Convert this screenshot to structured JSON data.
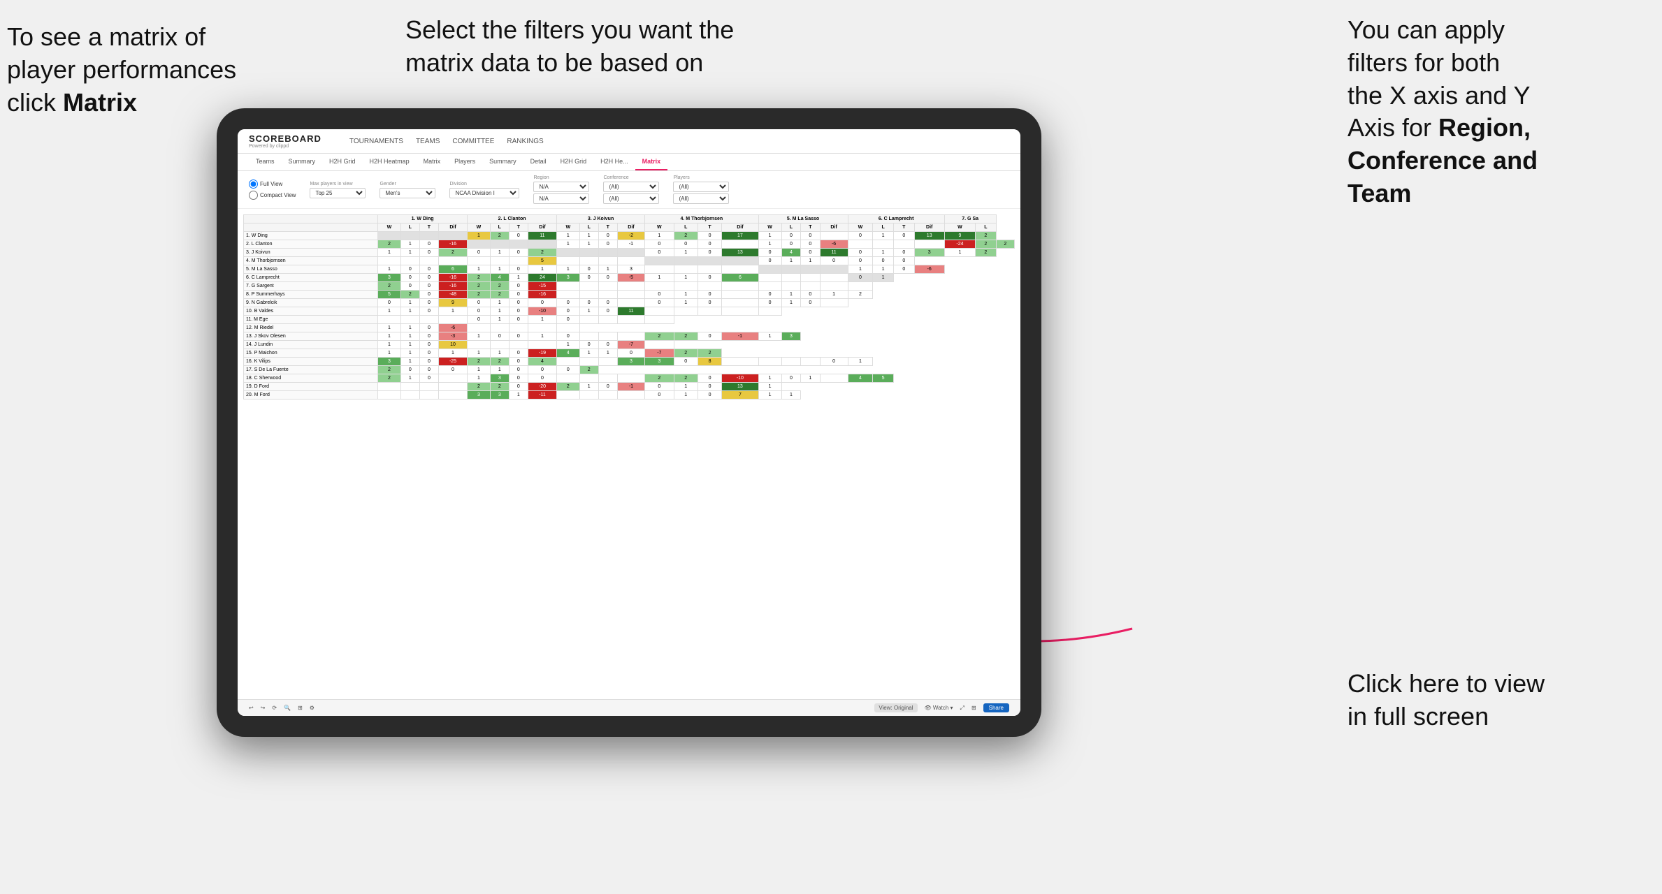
{
  "annotations": {
    "topleft": {
      "line1": "To see a matrix of",
      "line2": "player performances",
      "line3_normal": "click ",
      "line3_bold": "Matrix"
    },
    "topcenter": {
      "text": "Select the filters you want the matrix data to be based on"
    },
    "topright": {
      "line1": "You  can apply",
      "line2": "filters for both",
      "line3": "the X axis and Y",
      "line4_normal": "Axis for ",
      "line4_bold": "Region,",
      "line5": "Conference and",
      "line6": "Team"
    },
    "bottomright": {
      "line1": "Click here to view",
      "line2": "in full screen"
    }
  },
  "scoreboard": {
    "brand": "SCOREBOARD",
    "brand_sub": "Powered by clippd",
    "top_nav": [
      "TOURNAMENTS",
      "TEAMS",
      "COMMITTEE",
      "RANKINGS"
    ],
    "sub_tabs": [
      "Teams",
      "Summary",
      "H2H Grid",
      "H2H Heatmap",
      "Matrix",
      "Players",
      "Summary",
      "Detail",
      "H2H Grid",
      "H2H He...",
      "Matrix"
    ],
    "active_tab": "Matrix"
  },
  "filters": {
    "view_options": [
      "Full View",
      "Compact View"
    ],
    "max_players": {
      "label": "Max players in view",
      "value": "Top 25"
    },
    "gender": {
      "label": "Gender",
      "value": "Men's"
    },
    "division": {
      "label": "Division",
      "value": "NCAA Division I"
    },
    "region": {
      "label": "Region",
      "value": "N/A"
    },
    "conference": {
      "label": "Conference",
      "value": "(All)"
    },
    "players": {
      "label": "Players",
      "value": "(All)"
    },
    "region2": {
      "label": "",
      "value": "N/A"
    },
    "conference2": {
      "label": "",
      "value": "(All)"
    },
    "players2": {
      "label": "",
      "value": "(All)"
    }
  },
  "matrix": {
    "col_headers": [
      "1. W Ding",
      "2. L Clanton",
      "3. J Koivun",
      "4. M Thorbjornsen",
      "5. M La Sasso",
      "6. C Lamprecht",
      "7. G Sa"
    ],
    "sub_headers": [
      "W",
      "L",
      "T",
      "Dif"
    ],
    "rows": [
      {
        "name": "1. W Ding",
        "cells": [
          "",
          "",
          "",
          "",
          "1",
          "2",
          "0",
          "11",
          "1",
          "1",
          "0",
          "-2",
          "1",
          "2",
          "0",
          "17",
          "1",
          "0",
          "0",
          "",
          "0",
          "1",
          "0",
          "13",
          "9",
          "2"
        ]
      },
      {
        "name": "2. L Clanton",
        "cells": [
          "2",
          "1",
          "0",
          "-16",
          "",
          "",
          "",
          "",
          "1",
          "1",
          "0",
          "-1",
          "0",
          "0",
          "0",
          "",
          "1",
          "0",
          "0",
          "-6",
          "",
          "",
          "",
          "",
          "-24",
          "2",
          "2"
        ]
      },
      {
        "name": "3. J Koivun",
        "cells": [
          "1",
          "1",
          "0",
          "2",
          "0",
          "1",
          "0",
          "2",
          "",
          "",
          "",
          "",
          "0",
          "1",
          "0",
          "13",
          "0",
          "4",
          "0",
          "11",
          "0",
          "1",
          "0",
          "3",
          "1",
          "2"
        ]
      },
      {
        "name": "4. M Thorbjornsen",
        "cells": [
          "",
          "",
          "",
          "",
          "",
          "",
          "",
          "5",
          "",
          "",
          "",
          "",
          "",
          "",
          "",
          "",
          "0",
          "1",
          "1",
          "0",
          "0",
          "0",
          "0"
        ]
      },
      {
        "name": "5. M La Sasso",
        "cells": [
          "1",
          "0",
          "0",
          "6",
          "1",
          "1",
          "0",
          "1",
          "1",
          "0",
          "1",
          "3",
          "",
          "",
          "",
          "",
          "",
          "",
          "",
          "",
          "1",
          "1",
          "0",
          "-6"
        ]
      },
      {
        "name": "6. C Lamprecht",
        "cells": [
          "3",
          "0",
          "0",
          "-16",
          "2",
          "4",
          "1",
          "24",
          "3",
          "0",
          "0",
          "-5",
          "1",
          "1",
          "0",
          "6",
          "",
          "",
          "",
          "",
          "0",
          "1"
        ]
      },
      {
        "name": "7. G Sargent",
        "cells": [
          "2",
          "0",
          "0",
          "-16",
          "2",
          "2",
          "0",
          "-15",
          "",
          "",
          "",
          "",
          "",
          "",
          "",
          "",
          "",
          "",
          "",
          "",
          ""
        ]
      },
      {
        "name": "8. P Summerhays",
        "cells": [
          "5",
          "2",
          "0",
          "-48",
          "2",
          "2",
          "0",
          "-16",
          "",
          "",
          "",
          "",
          "0",
          "1",
          "0",
          "",
          "0",
          "1",
          "0",
          "1",
          "2"
        ]
      },
      {
        "name": "9. N Gabrelcik",
        "cells": [
          "0",
          "1",
          "0",
          "9",
          "0",
          "1",
          "0",
          "0",
          "0",
          "0",
          "0",
          "",
          "0",
          "1",
          "0",
          "",
          "0",
          "1",
          "0",
          ""
        ]
      },
      {
        "name": "10. B Valdes",
        "cells": [
          "1",
          "1",
          "0",
          "1",
          "0",
          "1",
          "0",
          "-10",
          "0",
          "1",
          "0",
          "11",
          "",
          "",
          "",
          "",
          ""
        ]
      },
      {
        "name": "11. M Ege",
        "cells": [
          "",
          "",
          "",
          "",
          "0",
          "1",
          "0",
          "1",
          "0",
          "",
          "",
          "",
          ""
        ]
      },
      {
        "name": "12. M Riedel",
        "cells": [
          "1",
          "1",
          "0",
          "-6",
          "",
          "",
          "",
          "",
          ""
        ]
      },
      {
        "name": "13. J Skov Olesen",
        "cells": [
          "1",
          "1",
          "0",
          "-3",
          "1",
          "0",
          "0",
          "1",
          "0",
          "",
          "",
          "",
          "2",
          "2",
          "0",
          "-1",
          "1",
          "3"
        ]
      },
      {
        "name": "14. J Lundin",
        "cells": [
          "1",
          "1",
          "0",
          "10",
          "",
          "",
          "",
          "",
          "1",
          "0",
          "0",
          "-7",
          ""
        ]
      },
      {
        "name": "15. P Maichon",
        "cells": [
          "1",
          "1",
          "0",
          "1",
          "1",
          "1",
          "0",
          "-19",
          "4",
          "1",
          "1",
          "0",
          "-7",
          "2",
          "2"
        ]
      },
      {
        "name": "16. K Vilips",
        "cells": [
          "3",
          "1",
          "0",
          "-25",
          "2",
          "2",
          "0",
          "4",
          "",
          "",
          "",
          "3",
          "3",
          "0",
          "8",
          "",
          "",
          "",
          "",
          "0",
          "1"
        ]
      },
      {
        "name": "17. S De La Fuente",
        "cells": [
          "2",
          "0",
          "0",
          "0",
          "1",
          "1",
          "0",
          "0",
          "0",
          "2"
        ]
      },
      {
        "name": "18. C Sherwood",
        "cells": [
          "2",
          "1",
          "0",
          "",
          "1",
          "3",
          "0",
          "0",
          "",
          "",
          "",
          "",
          "2",
          "2",
          "0",
          "-10",
          "1",
          "0",
          "1",
          "",
          "4",
          "5"
        ]
      },
      {
        "name": "19. D Ford",
        "cells": [
          "",
          "",
          "",
          "",
          "2",
          "2",
          "0",
          "-20",
          "2",
          "1",
          "0",
          "-1",
          "0",
          "1",
          "0",
          "13",
          "1"
        ]
      },
      {
        "name": "20. M Ford",
        "cells": [
          "",
          "",
          "",
          "",
          "3",
          "3",
          "1",
          "-11",
          "",
          "",
          "",
          "",
          "0",
          "1",
          "0",
          "7",
          "1",
          "1"
        ]
      }
    ]
  },
  "toolbar": {
    "view_label": "View: Original",
    "watch_label": "Watch",
    "share_label": "Share"
  }
}
